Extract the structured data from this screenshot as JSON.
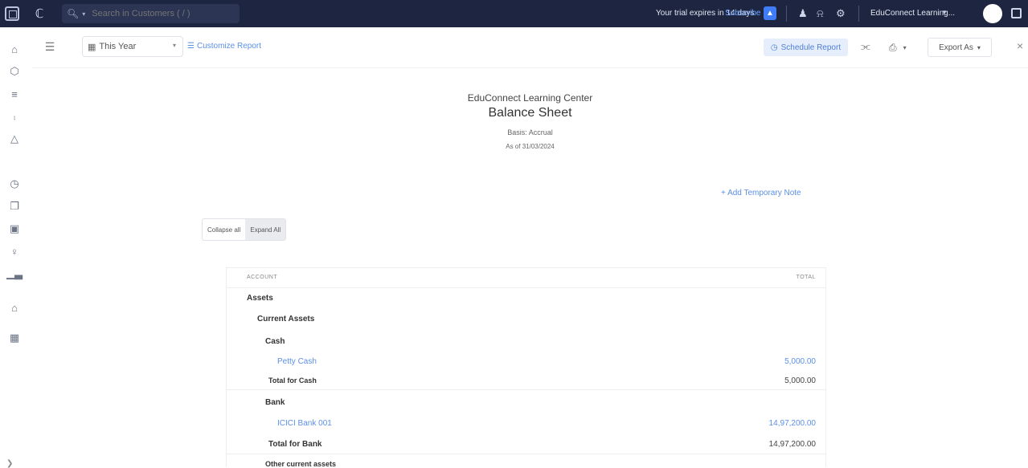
{
  "topbar": {
    "search_placeholder": "Search in Customers ( / )",
    "trial_text": "Your trial expires in 14 days",
    "subscribe": "Subscribe",
    "org_name": "EduConnect Learning...",
    "icons": [
      "app-logo-icon",
      "organization-icon",
      "search-icon",
      "bell-icon",
      "settings-icon",
      "apps-icon"
    ]
  },
  "sidebar": {
    "icons": [
      "home-icon",
      "box-icon",
      "bank-icon",
      "cart-icon",
      "bag-icon",
      "clock-icon",
      "documents-icon",
      "report-icon",
      "users-icon",
      "chart-icon",
      "shop-icon",
      "calendar-icon",
      "collapse-icon"
    ]
  },
  "toolbar": {
    "period": "This Year",
    "customize": "Customize Report",
    "schedule": "Schedule Report",
    "export": "Export As"
  },
  "report": {
    "company": "EduConnect Learning Center",
    "title": "Balance Sheet",
    "basis": "Basis: Accrual",
    "as_of": "As of 31/03/2024",
    "add_note": "+ Add Temporary Note",
    "collapse_all": "Collapse all",
    "expand_all": "Expand All",
    "columns": {
      "account": "ACCOUNT",
      "total": "TOTAL"
    },
    "rows": [
      {
        "label": "Assets",
        "amount": ""
      },
      {
        "label": "Current Assets",
        "amount": ""
      },
      {
        "label": "Cash",
        "amount": ""
      },
      {
        "label": "Petty Cash",
        "amount": "5,000.00"
      },
      {
        "label": "Total for Cash",
        "amount": "5,000.00"
      },
      {
        "label": "Bank",
        "amount": ""
      },
      {
        "label": "ICICI Bank 001",
        "amount": "14,97,200.00"
      },
      {
        "label": "Total for Bank",
        "amount": "14,97,200.00"
      },
      {
        "label": "Other current assets",
        "amount": ""
      }
    ]
  },
  "colors": {
    "topbar": "#1d2540",
    "accent": "#5b8fe8",
    "subscribe_button": "#3f7cf5"
  }
}
